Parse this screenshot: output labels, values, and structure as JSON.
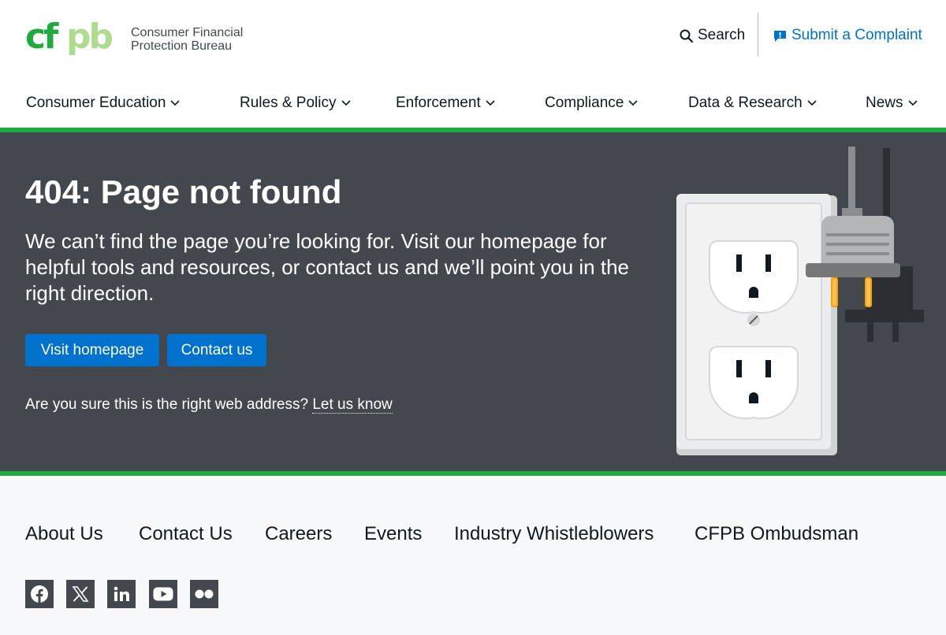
{
  "header": {
    "logo_text": "cfpb",
    "org_name_line1": "Consumer Financial",
    "org_name_line2": "Protection Bureau",
    "search_label": "Search",
    "complaint_label": "Submit a Complaint"
  },
  "nav": {
    "items": [
      {
        "label": "Consumer Education"
      },
      {
        "label": "Rules & Policy"
      },
      {
        "label": "Enforcement"
      },
      {
        "label": "Compliance"
      },
      {
        "label": "Data & Research"
      },
      {
        "label": "News"
      }
    ]
  },
  "hero": {
    "title": "404: Page not found",
    "lead": "We can’t find the page you’re looking for. Visit our homepage for helpful tools and resources, or contact us and we’ll point you in the right direction.",
    "primary_button": "Visit homepage",
    "secondary_button": "Contact us",
    "prompt": "Are you sure this is the right web address?",
    "prompt_link": "Let us know",
    "illustration_icon": "unplugged-outlet-icon"
  },
  "footer": {
    "links": [
      {
        "label": "About Us"
      },
      {
        "label": "Contact Us"
      },
      {
        "label": "Careers"
      },
      {
        "label": "Events"
      },
      {
        "label": "Industry Whistleblowers"
      },
      {
        "label": "CFPB Ombudsman"
      }
    ],
    "social": [
      {
        "icon": "facebook-icon"
      },
      {
        "icon": "x-icon"
      },
      {
        "icon": "linkedin-icon"
      },
      {
        "icon": "youtube-icon"
      },
      {
        "icon": "flickr-icon"
      }
    ]
  },
  "colors": {
    "brand_green": "#20aa3f",
    "logo_light_green": "#addc91",
    "link_blue": "#0072ce",
    "hero_bg": "#43484e",
    "footer_bg": "#f7f8f9"
  }
}
